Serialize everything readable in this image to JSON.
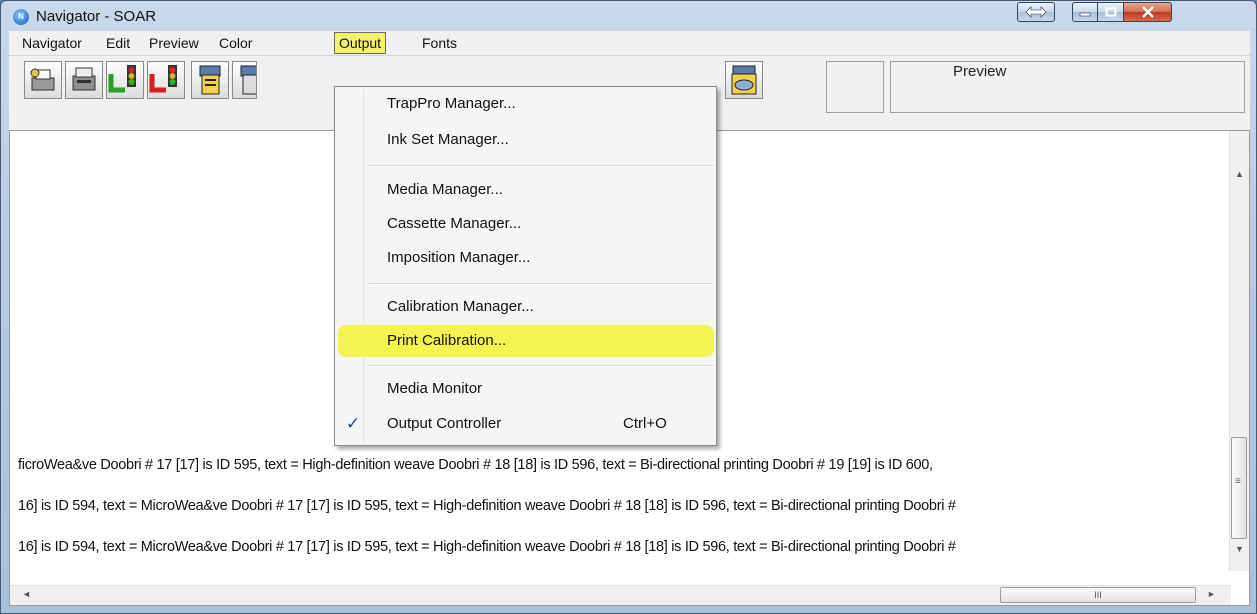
{
  "window": {
    "title": "Navigator - SOAR",
    "app_icon_text": "N"
  },
  "menubar": {
    "items": [
      "Navigator",
      "Edit",
      "Preview",
      "Color",
      "Output",
      "Fonts"
    ],
    "active": "Output"
  },
  "toolbar": {
    "preview_label": "Preview"
  },
  "output_menu": {
    "groups": [
      [
        "TrapPro Manager...",
        "Ink Set Manager..."
      ],
      [
        "Media Manager...",
        "Cassette Manager...",
        "Imposition Manager..."
      ],
      [
        "Calibration Manager...",
        "Print Calibration..."
      ],
      [
        "Media Monitor",
        "Output Controller"
      ]
    ],
    "highlighted": "Print Calibration...",
    "checked_item": "Output Controller",
    "output_controller_shortcut": "Ctrl+O",
    "highlight_color": "#f4f43f"
  },
  "content": {
    "lines": [
      "ficroWea&ve   Doobri # 17 [17] is ID 595, text = High-definition weave   Doobri # 18 [18] is ID 596, text = Bi-directional printing   Doobri # 19 [19] is ID 600,",
      "16] is ID 594, text = MicroWea&ve   Doobri # 17 [17] is ID 595, text = High-definition weave   Doobri # 18 [18] is ID 596, text = Bi-directional printing   Doobri #",
      "16] is ID 594, text = MicroWea&ve   Doobri # 17 [17] is ID 595, text = High-definition weave   Doobri # 18 [18] is ID 596, text = Bi-directional printing   Doobri #"
    ]
  },
  "scrollbars": {
    "up_arrow": "▲",
    "down_arrow": "▼",
    "left_arrow": "◄",
    "right_arrow": "►",
    "grip_h": "III",
    "grip_v": "≡"
  }
}
